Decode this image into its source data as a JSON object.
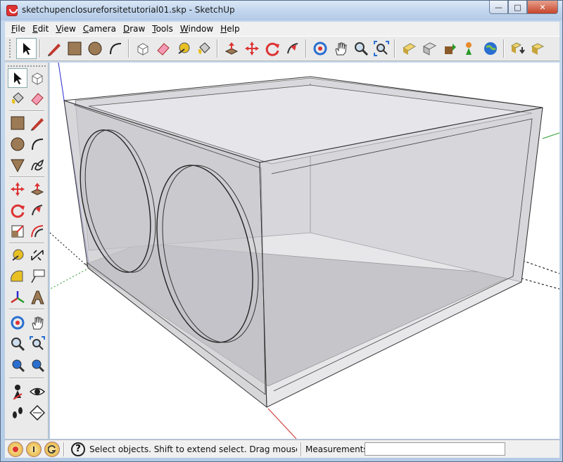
{
  "window": {
    "title": "sketchupenclosureforsitetutorial01.skp - SketchUp",
    "buttons": {
      "minimize": "—",
      "maximize": "□",
      "close": "✕"
    }
  },
  "menu": [
    "File",
    "Edit",
    "View",
    "Camera",
    "Draw",
    "Tools",
    "Window",
    "Help"
  ],
  "toolbar": {
    "tools": [
      "select",
      "line",
      "rectangle",
      "circle",
      "arc",
      "make-component",
      "eraser",
      "tape-measure",
      "paint-bucket",
      "push-pull",
      "move",
      "rotate",
      "follow-me",
      "orbit",
      "pan",
      "zoom",
      "zoom-extents",
      "get-models",
      "share-model",
      "place-model",
      "get-photo-texture",
      "google-earth",
      "component-browser",
      "extension"
    ]
  },
  "palette": {
    "tools": [
      "select",
      "make-component",
      "paint-bucket",
      "eraser",
      "rectangle",
      "line",
      "circle",
      "arc",
      "polygon",
      "freehand",
      "move",
      "push-pull",
      "rotate",
      "follow-me",
      "scale",
      "offset",
      "tape-measure",
      "dimension",
      "protractor",
      "text",
      "axes",
      "3d-text",
      "orbit",
      "pan",
      "zoom",
      "zoom-window",
      "previous",
      "zoom-extents",
      "position-camera",
      "look-around",
      "walk",
      "section-plane"
    ]
  },
  "status": {
    "message": "Select objects. Shift to extend select. Drag mouse",
    "measurements_label": "Measurements",
    "measurements_value": ""
  },
  "colors": {
    "axis_red": "#cc2b2b",
    "axis_green": "#2a9a2a",
    "axis_blue": "#2a2ad0",
    "glass": "#c8c8cc"
  }
}
